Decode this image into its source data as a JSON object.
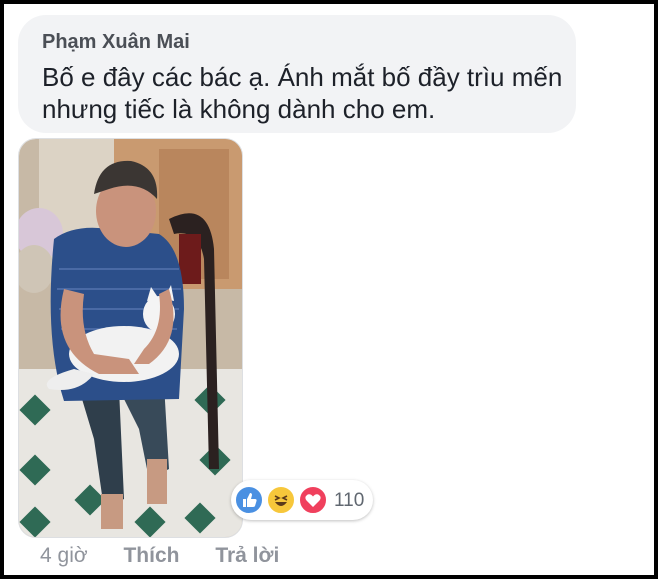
{
  "comment": {
    "author": "Phạm Xuân Mai",
    "text": "Bố e đây các bác ạ. Ánh mắt bố đầy trìu mến nhưng tiếc là không dành cho em."
  },
  "reactions": {
    "icons": [
      "like-icon",
      "haha-icon",
      "love-icon"
    ],
    "count": "110",
    "colors": {
      "like": "#4a90e2",
      "haha": "#f7c73b",
      "love": "#f0405d"
    }
  },
  "actions": {
    "timestamp": "4 giờ",
    "like_label": "Thích",
    "reply_label": "Trả lời"
  }
}
